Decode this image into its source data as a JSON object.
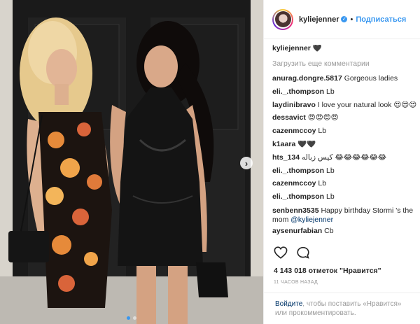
{
  "post": {
    "username": "kyliejenner",
    "follow_label": "Подписаться",
    "separator": "•",
    "accent_color": "#3897f0"
  },
  "caption": {
    "username": "kyliejenner",
    "text": "🖤"
  },
  "load_more": "Загрузить еще комментарии",
  "comments": [
    {
      "user": "anurag.dongre.5817",
      "text": "Gorgeous ladies"
    },
    {
      "user": "eli._.thompson",
      "text": "Lb"
    },
    {
      "user": "laydinibravo",
      "text": "I love your natural look 😍😍😍"
    },
    {
      "user": "dessavict",
      "text": "😍😍😍😍"
    },
    {
      "user": "cazenmccoy",
      "text": "Lb"
    },
    {
      "user": "k1aara",
      "text": "🖤🖤"
    },
    {
      "user": "hts_134",
      "text": "كيس زباله 😂😂😂😂😂😂"
    },
    {
      "user": "eli._.thompson",
      "text": "Lb"
    },
    {
      "user": "cazenmccoy",
      "text": "Lb"
    },
    {
      "user": "eli._.thompson",
      "text": "Lb"
    },
    {
      "user": "senbenn3535",
      "text": "Happy birthday Stormi 's the mom ",
      "mention": "@kyliejenner"
    },
    {
      "user": "aysenurfabian",
      "text": "Cb"
    }
  ],
  "likes": "4 143 018 отметок \"Нравится\"",
  "time": "11 ЧАСОВ НАЗАД",
  "login": {
    "link": "Войдите",
    "text": ", чтобы поставить «Нравится» или прокомментировать."
  },
  "icons": {
    "like": "heart-icon",
    "comment": "comment-icon",
    "next": "chevron-right-icon",
    "verified": "verified-check-icon"
  }
}
